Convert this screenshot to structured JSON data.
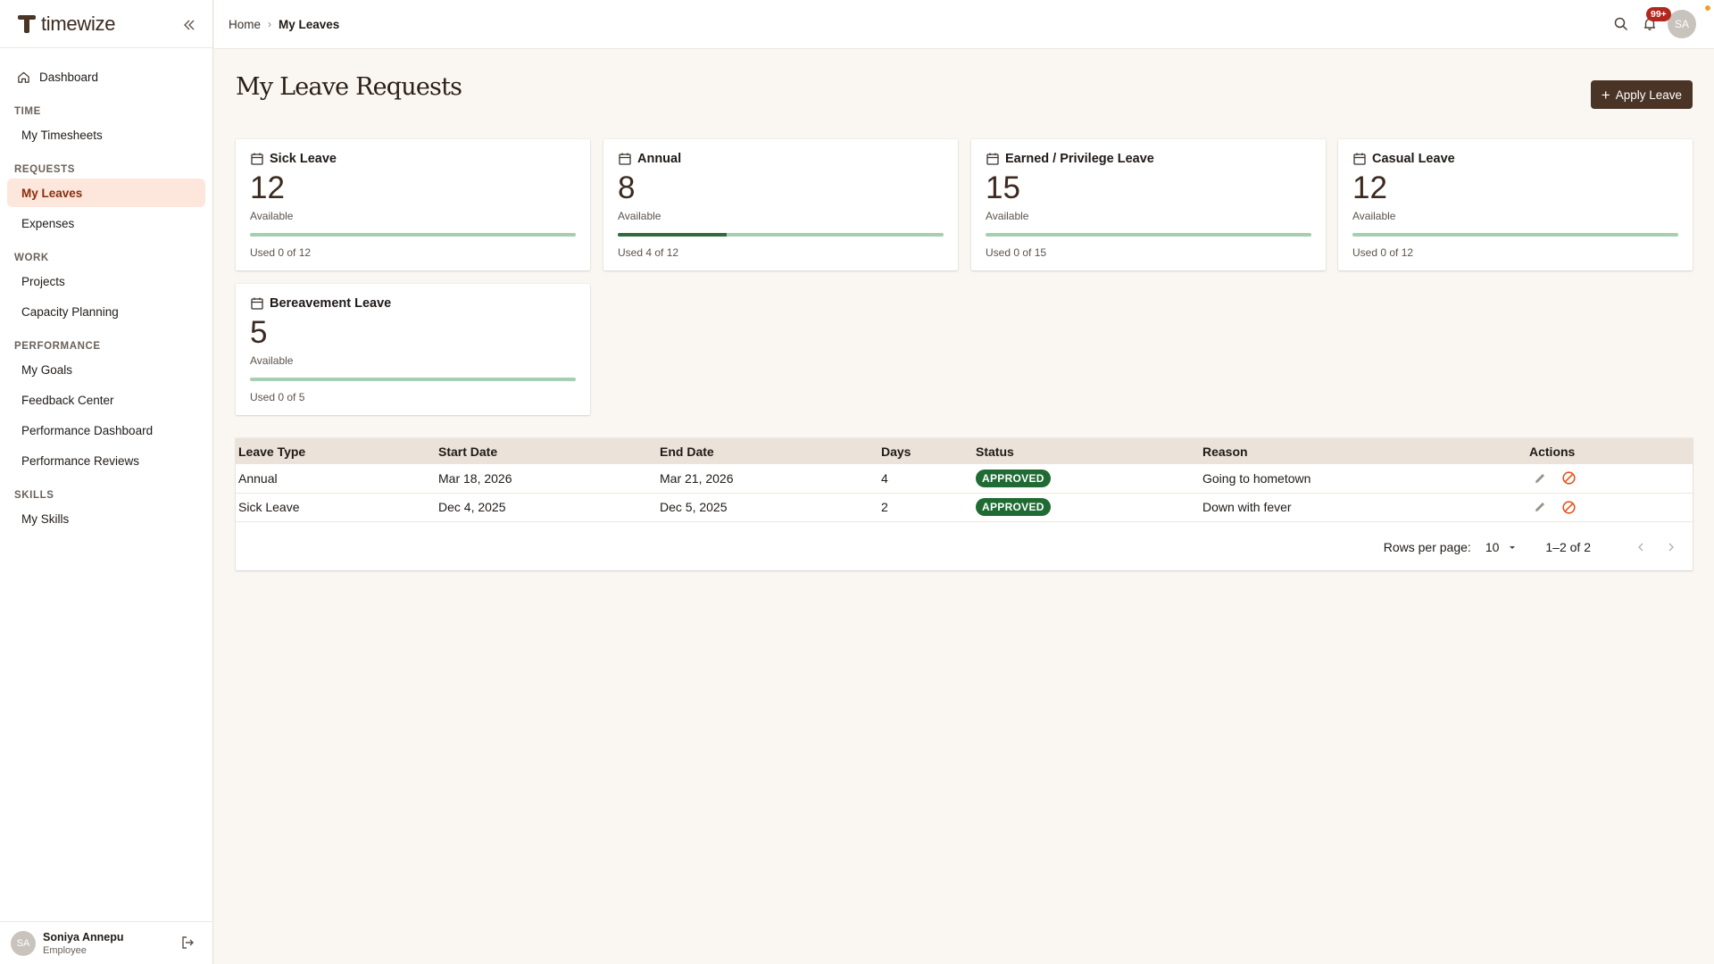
{
  "brand": {
    "name": "timewize"
  },
  "sidebar": {
    "dashboard": "Dashboard",
    "sections": [
      {
        "title": "TIME",
        "items": [
          {
            "label": "My Timesheets"
          }
        ]
      },
      {
        "title": "REQUESTS",
        "items": [
          {
            "label": "My Leaves",
            "active": true
          },
          {
            "label": "Expenses"
          }
        ]
      },
      {
        "title": "WORK",
        "items": [
          {
            "label": "Projects"
          },
          {
            "label": "Capacity Planning"
          }
        ]
      },
      {
        "title": "PERFORMANCE",
        "items": [
          {
            "label": "My Goals"
          },
          {
            "label": "Feedback Center"
          },
          {
            "label": "Performance Dashboard"
          },
          {
            "label": "Performance Reviews"
          }
        ]
      },
      {
        "title": "SKILLS",
        "items": [
          {
            "label": "My Skills"
          }
        ]
      }
    ],
    "user": {
      "initials": "SA",
      "name": "Soniya Annepu",
      "role": "Employee"
    }
  },
  "header": {
    "breadcrumb": [
      "Home",
      "My Leaves"
    ],
    "notifications_badge": "99+",
    "avatar_initials": "SA"
  },
  "main": {
    "title": "My Leave Requests",
    "apply_button": "Apply Leave",
    "cards": [
      {
        "title": "Sick Leave",
        "available": "12",
        "available_label": "Available",
        "used_text": "Used 0 of 12",
        "used_fraction": 0
      },
      {
        "title": "Annual",
        "available": "8",
        "available_label": "Available",
        "used_text": "Used 4 of 12",
        "used_fraction": 0.3333
      },
      {
        "title": "Earned / Privilege Leave",
        "available": "15",
        "available_label": "Available",
        "used_text": "Used 0 of 15",
        "used_fraction": 0
      },
      {
        "title": "Casual Leave",
        "available": "12",
        "available_label": "Available",
        "used_text": "Used 0 of 12",
        "used_fraction": 0
      },
      {
        "title": "Bereavement Leave",
        "available": "5",
        "available_label": "Available",
        "used_text": "Used 0 of 5",
        "used_fraction": 0
      }
    ],
    "table": {
      "columns": [
        "Leave Type",
        "Start Date",
        "End Date",
        "Days",
        "Status",
        "Reason",
        "Actions"
      ],
      "rows": [
        {
          "type": "Annual",
          "start": "Mar 18, 2026",
          "end": "Mar 21, 2026",
          "days": "4",
          "status": "APPROVED",
          "reason": "Going to hometown"
        },
        {
          "type": "Sick Leave",
          "start": "Dec 4, 2025",
          "end": "Dec 5, 2025",
          "days": "2",
          "status": "APPROVED",
          "reason": "Down with fever"
        }
      ],
      "pagination": {
        "rows_per_page_label": "Rows per page:",
        "rows_per_page": "10",
        "range": "1–2 of 2"
      }
    }
  },
  "colors": {
    "accent": "#4a3426",
    "active_bg": "#fde6dc",
    "approved": "#1f6b33",
    "bar_track": "#a8cdb2",
    "bar_fill": "#2e6b3f",
    "badge": "#b3261e"
  }
}
